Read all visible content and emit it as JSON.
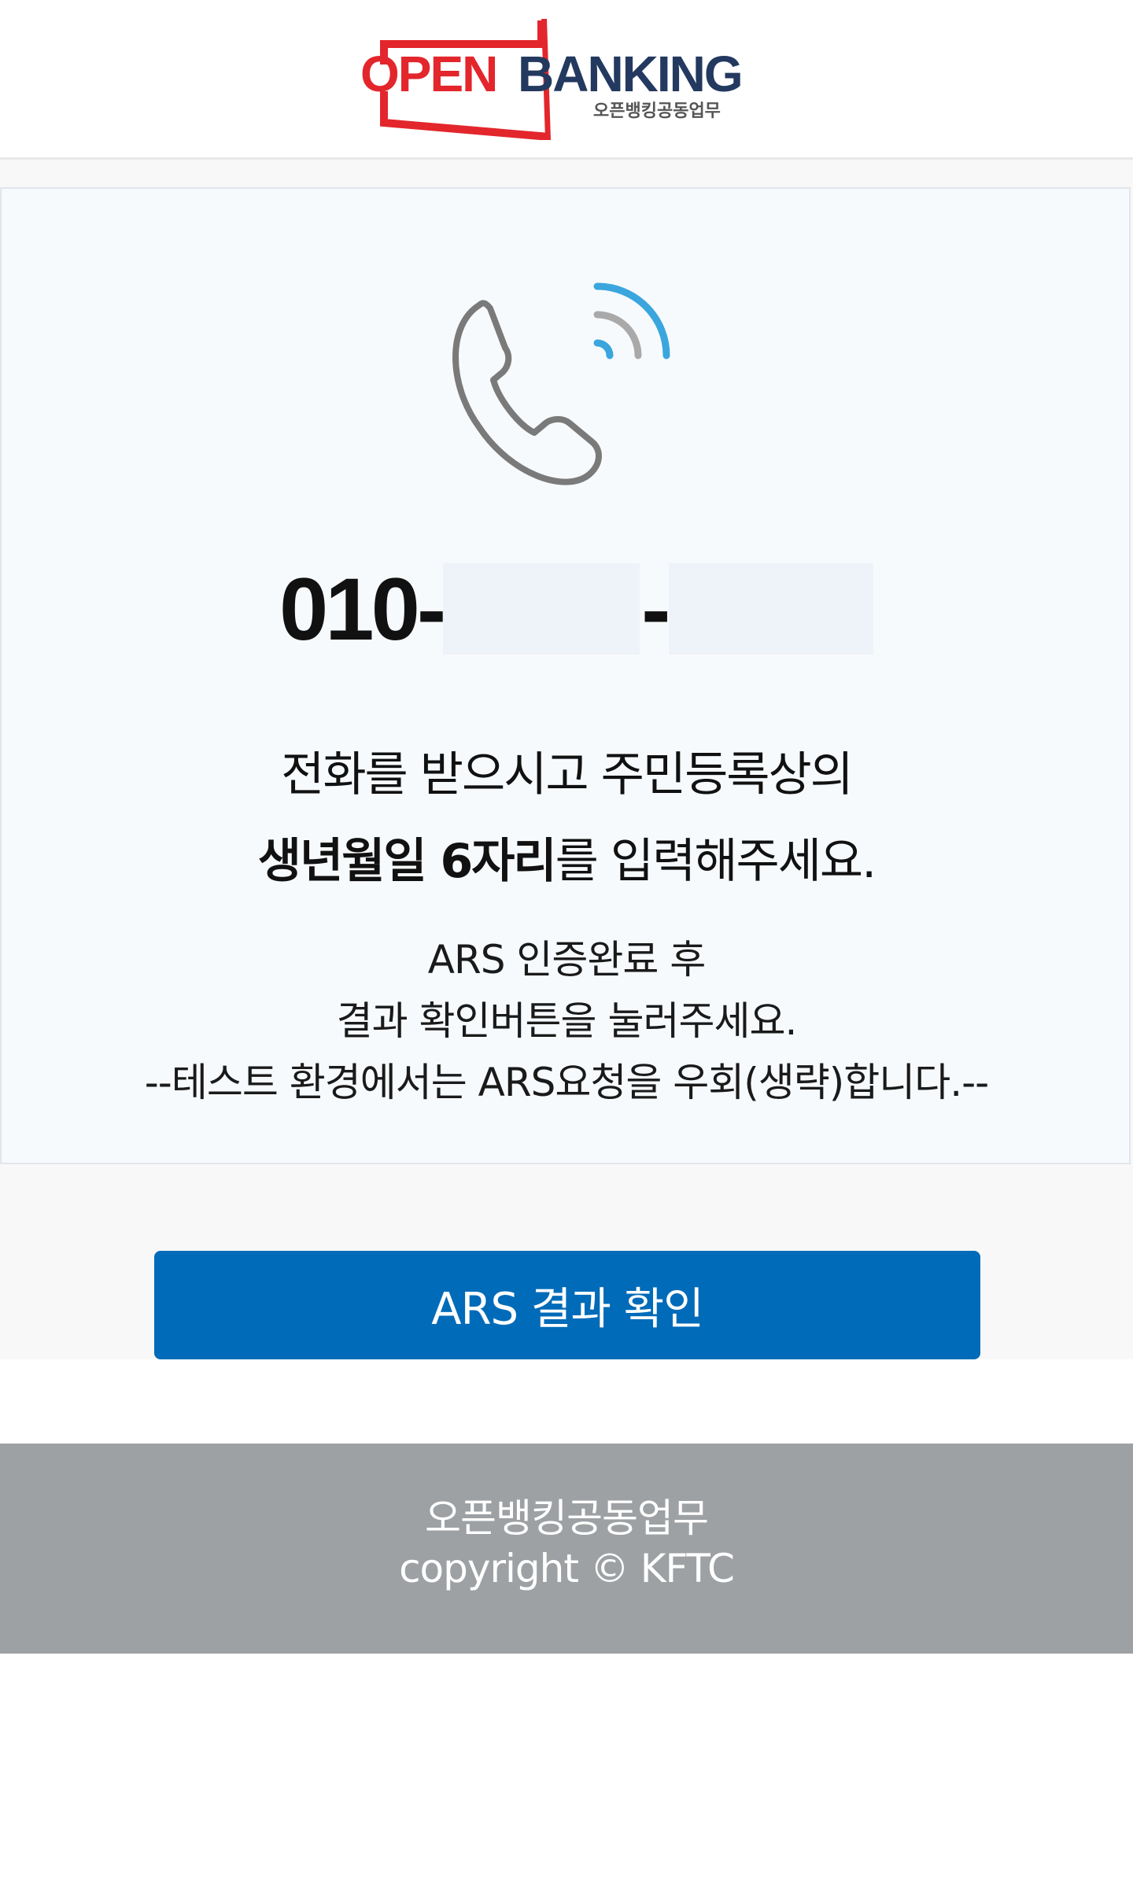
{
  "header": {
    "logo_text": "OPENBANKING",
    "logo_subtext": "오픈뱅킹공동업무"
  },
  "ars": {
    "phone_prefix": "010-",
    "phone_separator": "-",
    "message_line1": "전화를 받으시고 주민등록상의",
    "message_bold": "생년월일 6자리",
    "message_rest": "를 입력해주세요.",
    "sub_line1": "ARS 인증완료 후",
    "sub_line2": "결과 확인버튼을 눌러주세요.",
    "sub_line3": "--테스트 환경에서는 ARS요청을 우회(생략)합니다.--"
  },
  "button": {
    "label": "ARS 결과 확인"
  },
  "footer": {
    "line1": "오픈뱅킹공동업무",
    "line2": "copyright © KFTC"
  },
  "colors": {
    "primary_button": "#006bb8",
    "footer_bg": "#9ea1a4",
    "logo_red": "#e3262c",
    "logo_navy": "#23395f",
    "signal_blue": "#3aa6dd"
  },
  "icons": [
    "phone-calling-icon"
  ]
}
